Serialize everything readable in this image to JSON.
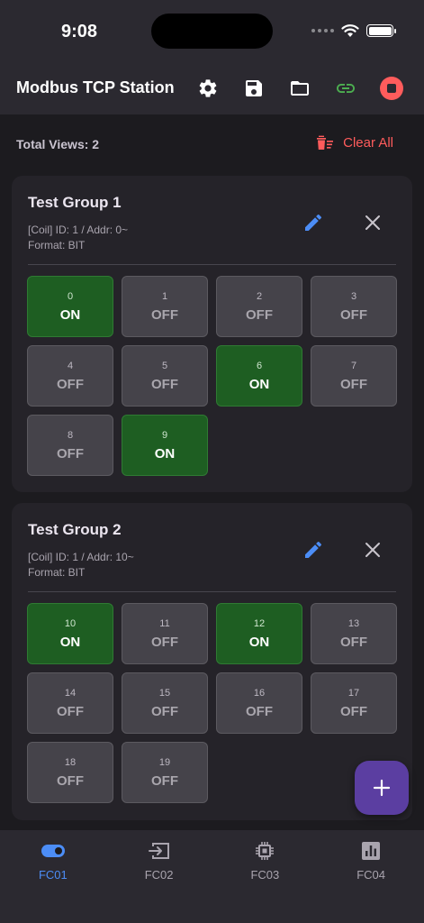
{
  "status_bar": {
    "time": "9:08"
  },
  "app_bar": {
    "title": "Modbus TCP Station",
    "icons": [
      "gear-icon",
      "save-icon",
      "folder-icon",
      "link-icon",
      "stop-icon"
    ],
    "link_color": "#4caf50",
    "stop_color": "#ff5c5c"
  },
  "summary": {
    "total_views": "Total Views: 2",
    "clear_all": "Clear All",
    "clear_color": "#ff5c5c"
  },
  "groups": [
    {
      "title": "Test Group 1",
      "info": "[Coil] ID: 1 / Addr: 0~",
      "format": "Format: BIT",
      "cells": [
        {
          "num": "0",
          "state": "ON"
        },
        {
          "num": "1",
          "state": "OFF"
        },
        {
          "num": "2",
          "state": "OFF"
        },
        {
          "num": "3",
          "state": "OFF"
        },
        {
          "num": "4",
          "state": "OFF"
        },
        {
          "num": "5",
          "state": "OFF"
        },
        {
          "num": "6",
          "state": "ON"
        },
        {
          "num": "7",
          "state": "OFF"
        },
        {
          "num": "8",
          "state": "OFF"
        },
        {
          "num": "9",
          "state": "ON"
        }
      ]
    },
    {
      "title": "Test Group 2",
      "info": "[Coil] ID: 1 / Addr: 10~",
      "format": "Format: BIT",
      "cells": [
        {
          "num": "10",
          "state": "ON"
        },
        {
          "num": "11",
          "state": "OFF"
        },
        {
          "num": "12",
          "state": "ON"
        },
        {
          "num": "13",
          "state": "OFF"
        },
        {
          "num": "14",
          "state": "OFF"
        },
        {
          "num": "15",
          "state": "OFF"
        },
        {
          "num": "16",
          "state": "OFF"
        },
        {
          "num": "17",
          "state": "OFF"
        },
        {
          "num": "18",
          "state": "OFF"
        },
        {
          "num": "19",
          "state": "OFF"
        }
      ]
    }
  ],
  "fab": {
    "icon": "plus-icon"
  },
  "bottom_nav": {
    "items": [
      {
        "label": "FC01",
        "icon": "toggle-icon",
        "active": true
      },
      {
        "label": "FC02",
        "icon": "input-icon",
        "active": false
      },
      {
        "label": "FC03",
        "icon": "chip-icon",
        "active": false
      },
      {
        "label": "FC04",
        "icon": "chart-box-icon",
        "active": false
      }
    ],
    "active_color": "#4c8df6"
  }
}
